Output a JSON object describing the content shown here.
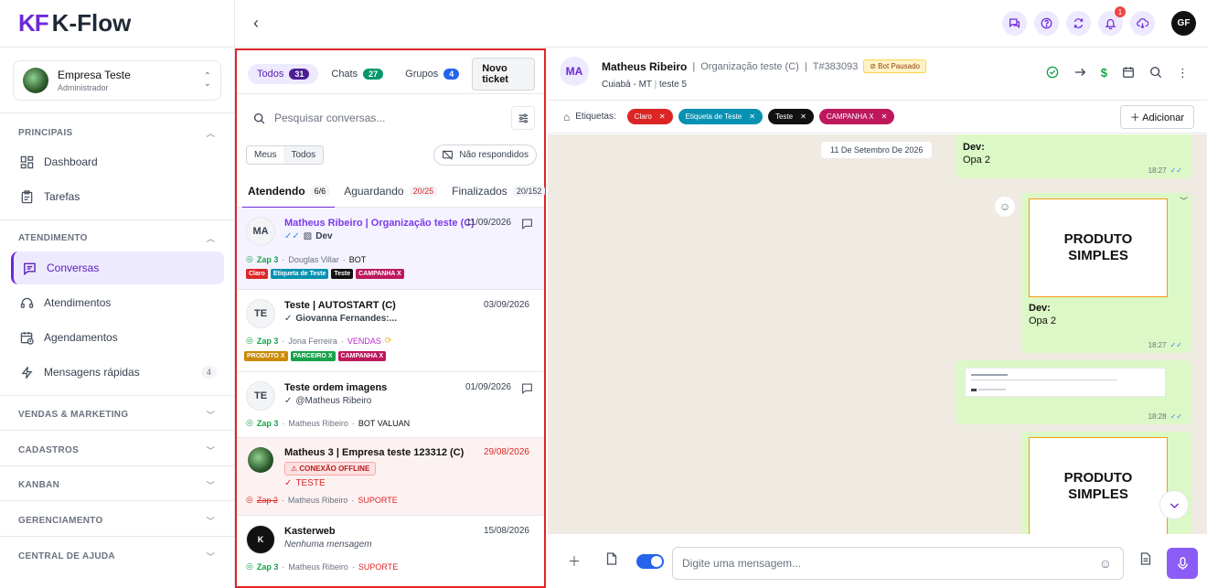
{
  "app": {
    "logo_mark": "KF",
    "logo_text": "K-Flow"
  },
  "company": {
    "name": "Empresa Teste",
    "role": "Administrador"
  },
  "sidebar": {
    "sections": {
      "principais": "PRINCIPAIS",
      "atendimento": "ATENDIMENTO",
      "vendas": "VENDAS & MARKETING",
      "cadastros": "CADASTROS",
      "kanban": "KANBAN",
      "gerenciamento": "GERENCIAMENTO",
      "ajuda": "CENTRAL DE AJUDA"
    },
    "items": {
      "dashboard": "Dashboard",
      "tarefas": "Tarefas",
      "conversas": "Conversas",
      "atendimentos": "Atendimentos",
      "agendamentos": "Agendamentos",
      "mensagens": "Mensagens rápidas",
      "mensagens_count": "4"
    }
  },
  "topbar": {
    "notif_count": "1",
    "user_initials": "GF"
  },
  "list": {
    "filters": {
      "todos": "Todos",
      "todos_count": "31",
      "chats": "Chats",
      "chats_count": "27",
      "grupos": "Grupos",
      "grupos_count": "4"
    },
    "new_ticket": "Novo ticket",
    "search_placeholder": "Pesquisar conversas...",
    "seg_meus": "Meus",
    "seg_todos": "Todos",
    "nao_respondidos": "Não respondidos",
    "tabs": {
      "atendendo": "Atendendo",
      "atendendo_count": "6/6",
      "aguardando": "Aguardando",
      "aguardando_count": "20/25",
      "finalizados": "Finalizados",
      "finalizados_count": "20/152"
    },
    "conversations": [
      {
        "initials": "MA",
        "title": "Matheus Ribeiro | Organização teste (C)",
        "date": "11/09/2026",
        "preview": "Dev",
        "zap": "Zap 3",
        "agent": "Douglas Villar",
        "queue": "BOT",
        "tags": [
          {
            "label": "Claro",
            "color": "#dc2626"
          },
          {
            "label": "Etiqueta de Teste",
            "color": "#0891b2"
          },
          {
            "label": "Teste",
            "color": "#111111"
          },
          {
            "label": "CAMPANHA X",
            "color": "#be185d"
          }
        ]
      },
      {
        "initials": "TE",
        "title": "Teste | AUTOSTART (C)",
        "date": "03/09/2026",
        "preview": "Giovanna Fernandes:...",
        "zap": "Zap 3",
        "agent": "Jona Ferreira",
        "queue": "VENDAS",
        "tags": [
          {
            "label": "PRODUTO X",
            "color": "#ca8a04"
          },
          {
            "label": "PARCEIRO X",
            "color": "#16a34a"
          },
          {
            "label": "CAMPANHA X",
            "color": "#be185d"
          }
        ]
      },
      {
        "initials": "TE",
        "title": "Teste ordem imagens",
        "date": "01/09/2026",
        "preview": "@Matheus Ribeiro",
        "zap": "Zap 3",
        "agent": "Matheus Ribeiro",
        "queue": "BOT VALUAN"
      },
      {
        "title": "Matheus 3 | Empresa teste 123312 (C)",
        "date": "29/08/2026",
        "offline": "CONEXÃO OFFLINE",
        "preview": "TESTE",
        "zap": "Zap 2",
        "agent": "Matheus Ribeiro",
        "queue": "SUPORTE"
      },
      {
        "title": "Kasterweb",
        "date": "15/08/2026",
        "preview": "Nenhuma mensagem",
        "zap": "Zap 3",
        "agent": "Matheus Ribeiro",
        "queue": "SUPORTE"
      }
    ]
  },
  "chat": {
    "initials": "MA",
    "name": "Matheus Ribeiro",
    "org": "Organização teste (C)",
    "ticket": "T#383093",
    "bot_status": "Bot Pausado",
    "location": "Cuiabá - MT",
    "sub": "teste 5",
    "labels_title": "Etiquetas:",
    "labels": [
      {
        "label": "Claro",
        "color": "#dc2626"
      },
      {
        "label": "Etiqueta de Teste",
        "color": "#0891b2"
      },
      {
        "label": "Teste",
        "color": "#111111"
      },
      {
        "label": "CAMPANHA X",
        "color": "#be185d"
      }
    ],
    "add_label": "Adicionar",
    "date_chip": "11 De Setembro De 2026",
    "messages": [
      {
        "who": "Dev:",
        "text": "Opa 2",
        "time": "18:27"
      },
      {
        "image_text_1": "PRODUTO",
        "image_text_2": "SIMPLES",
        "who": "Dev:",
        "text": "Opa 2",
        "time": "18:27"
      },
      {
        "time": "18:28"
      },
      {
        "image_text_1": "PRODUTO",
        "image_text_2": "SIMPLES"
      }
    ],
    "composer_placeholder": "Digite uma mensagem..."
  },
  "colors": {
    "accent": "#6d28d9",
    "highlight_border": "#dc2626",
    "bubble": "#dcf8c6"
  }
}
